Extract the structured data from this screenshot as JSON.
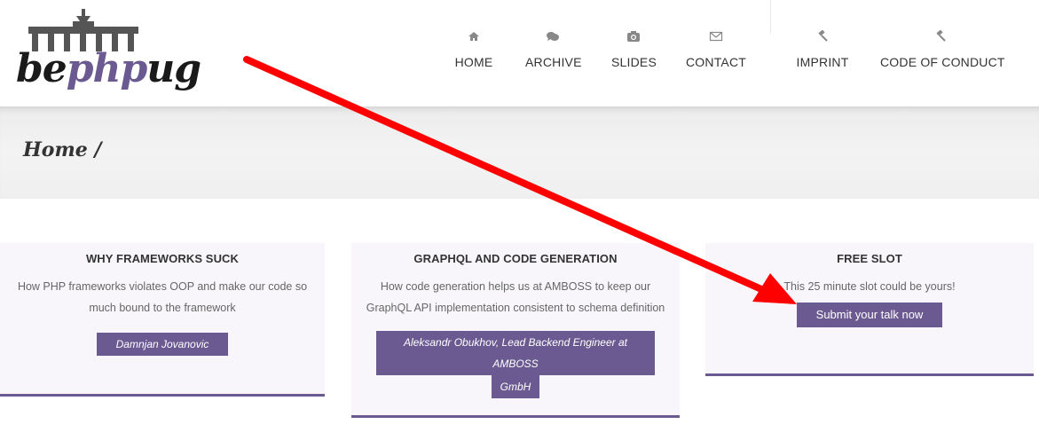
{
  "logo": {
    "part1": "be",
    "part2": "php",
    "part3": "ug"
  },
  "nav": [
    {
      "label": "HOME",
      "icon": "home-icon"
    },
    {
      "label": "ARCHIVE",
      "icon": "comments-icon"
    },
    {
      "label": "SLIDES",
      "icon": "camera-icon"
    },
    {
      "label": "CONTACT",
      "icon": "envelope-icon"
    },
    {
      "label": "IMPRINT",
      "icon": "gavel-icon"
    },
    {
      "label": "CODE OF CONDUCT",
      "icon": "gavel-icon"
    }
  ],
  "breadcrumb": "Home /",
  "cards": [
    {
      "title": "WHY FRAMEWORKS SUCK",
      "desc_line1": "How PHP frameworks violates OOP and make our code so",
      "desc_line2": "much bound to the framework",
      "button": "Damnjan Jovanovic"
    },
    {
      "title": "GRAPHQL AND CODE GENERATION",
      "desc_line1": "How code generation helps us at AMBOSS to keep our",
      "desc_line2": "GraphQL API implementation consistent to schema definition",
      "button_line1": "Aleksandr Obukhov, Lead Backend Engineer at AMBOSS",
      "button_line2": "GmbH"
    },
    {
      "title": "FREE SLOT",
      "desc": "This 25 minute slot could be yours!",
      "button": "Submit your talk now"
    }
  ],
  "colors": {
    "accent": "#6a5a91",
    "annotation_arrow": "#ff0000"
  }
}
